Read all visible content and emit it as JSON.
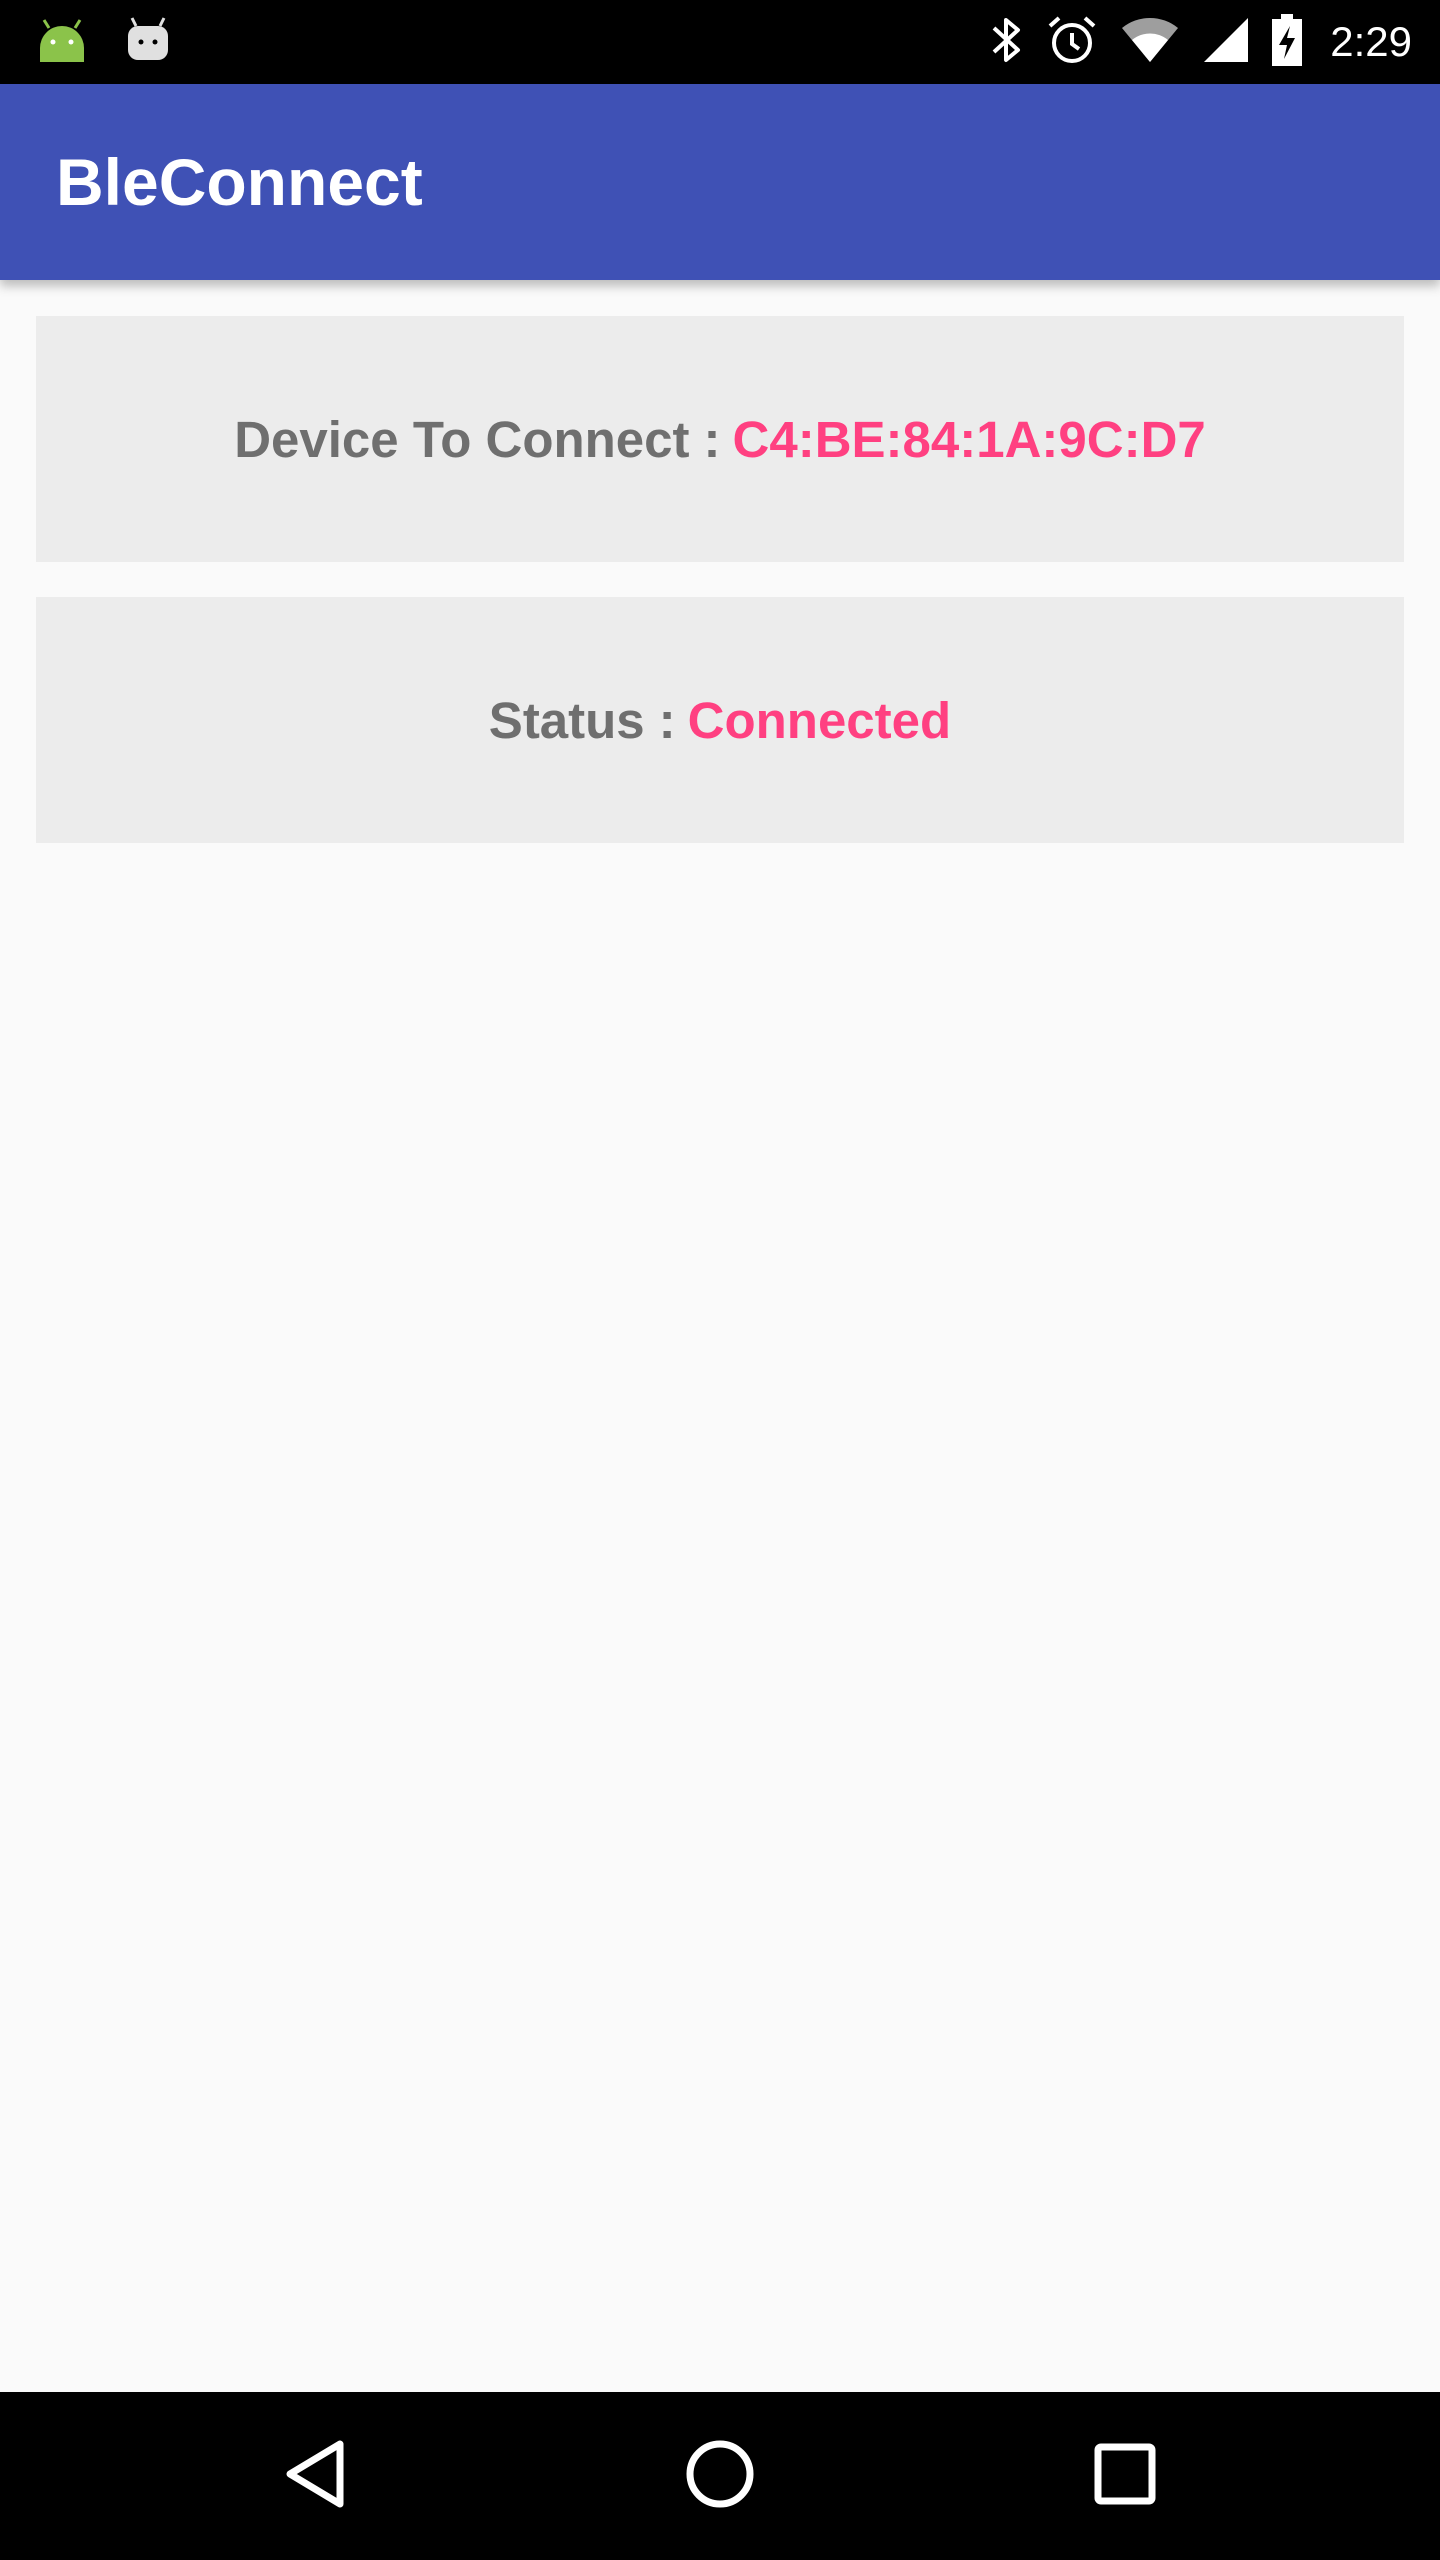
{
  "status_bar": {
    "time": "2:29",
    "left_icons": [
      "android-icon",
      "notification-robot-icon"
    ],
    "right_icons": [
      "bluetooth-icon",
      "alarm-icon",
      "wifi-icon",
      "signal-icon",
      "battery-charging-icon"
    ]
  },
  "app_bar": {
    "title": "BleConnect",
    "color": "#3f51b5"
  },
  "device_card": {
    "label": "Device To Connect",
    "separator": ":",
    "value": "C4:BE:84:1A:9C:D7"
  },
  "status_card": {
    "label": "Status",
    "separator": ":",
    "value": "Connected"
  },
  "nav_bar": {
    "buttons": [
      "back-icon",
      "home-icon",
      "recents-icon"
    ]
  },
  "colors": {
    "accent": "#ff4081",
    "label_text": "#6f6f6f",
    "card_background": "#ececec",
    "page_background": "#fafafa"
  }
}
